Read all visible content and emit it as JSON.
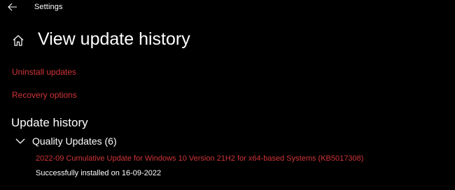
{
  "window": {
    "title": "Settings",
    "back_icon": "back-arrow-icon"
  },
  "header": {
    "home_icon": "home-icon",
    "title": "View update history"
  },
  "links": {
    "uninstall": "Uninstall updates",
    "recovery": "Recovery options"
  },
  "history": {
    "title": "Update history",
    "groups": [
      {
        "label": "Quality Updates (6)",
        "expanded": true,
        "items": [
          {
            "name": "2022-09 Cumulative Update for Windows 10 Version 21H2 for x64-based Systems (KB5017308)",
            "status": "Successfully installed on 16-09-2022"
          }
        ]
      }
    ]
  },
  "colors": {
    "background": "#000000",
    "accent_link": "#d13438",
    "text": "#ffffff"
  }
}
